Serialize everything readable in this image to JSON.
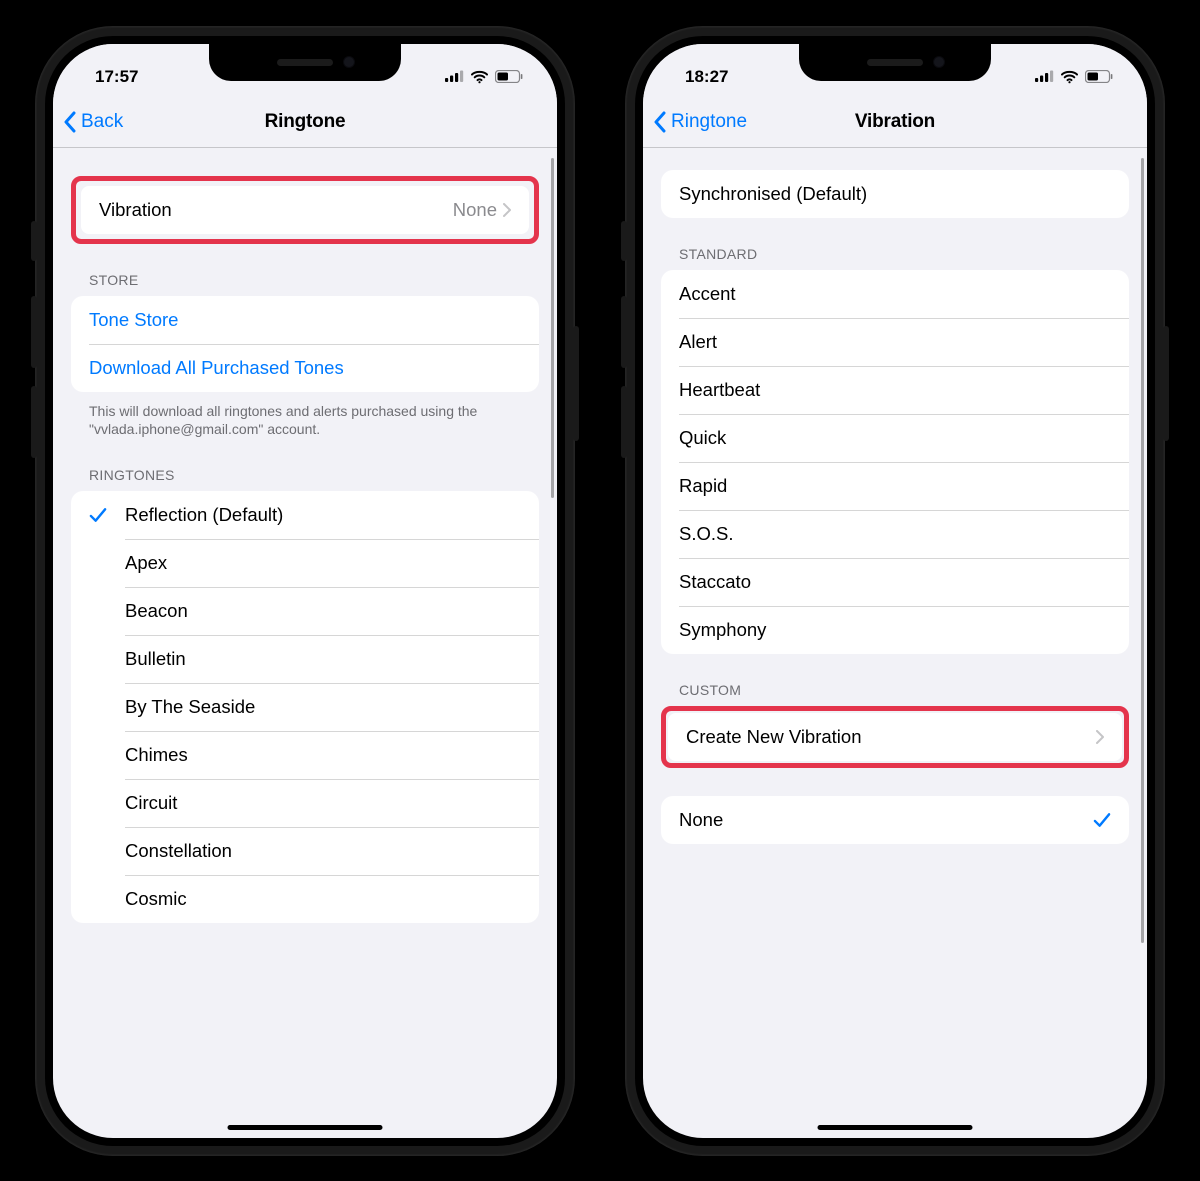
{
  "left": {
    "status": {
      "time": "17:57"
    },
    "nav": {
      "back": "Back",
      "title": "Ringtone"
    },
    "vibration": {
      "label": "Vibration",
      "value": "None"
    },
    "store": {
      "header": "STORE",
      "tone_store": "Tone Store",
      "download": "Download All Purchased Tones",
      "footer": "This will download all ringtones and alerts purchased using the \"vvlada.iphone@gmail.com\" account."
    },
    "ringtones": {
      "header": "RINGTONES",
      "items": [
        {
          "label": "Reflection (Default)",
          "selected": true
        },
        {
          "label": "Apex",
          "selected": false
        },
        {
          "label": "Beacon",
          "selected": false
        },
        {
          "label": "Bulletin",
          "selected": false
        },
        {
          "label": "By The Seaside",
          "selected": false
        },
        {
          "label": "Chimes",
          "selected": false
        },
        {
          "label": "Circuit",
          "selected": false
        },
        {
          "label": "Constellation",
          "selected": false
        },
        {
          "label": "Cosmic",
          "selected": false
        }
      ]
    }
  },
  "right": {
    "status": {
      "time": "18:27"
    },
    "nav": {
      "back": "Ringtone",
      "title": "Vibration"
    },
    "default": {
      "label": "Synchronised (Default)"
    },
    "standard": {
      "header": "STANDARD",
      "items": [
        "Accent",
        "Alert",
        "Heartbeat",
        "Quick",
        "Rapid",
        "S.O.S.",
        "Staccato",
        "Symphony"
      ]
    },
    "custom": {
      "header": "CUSTOM",
      "create": "Create New Vibration"
    },
    "none": {
      "label": "None",
      "selected": true
    }
  }
}
